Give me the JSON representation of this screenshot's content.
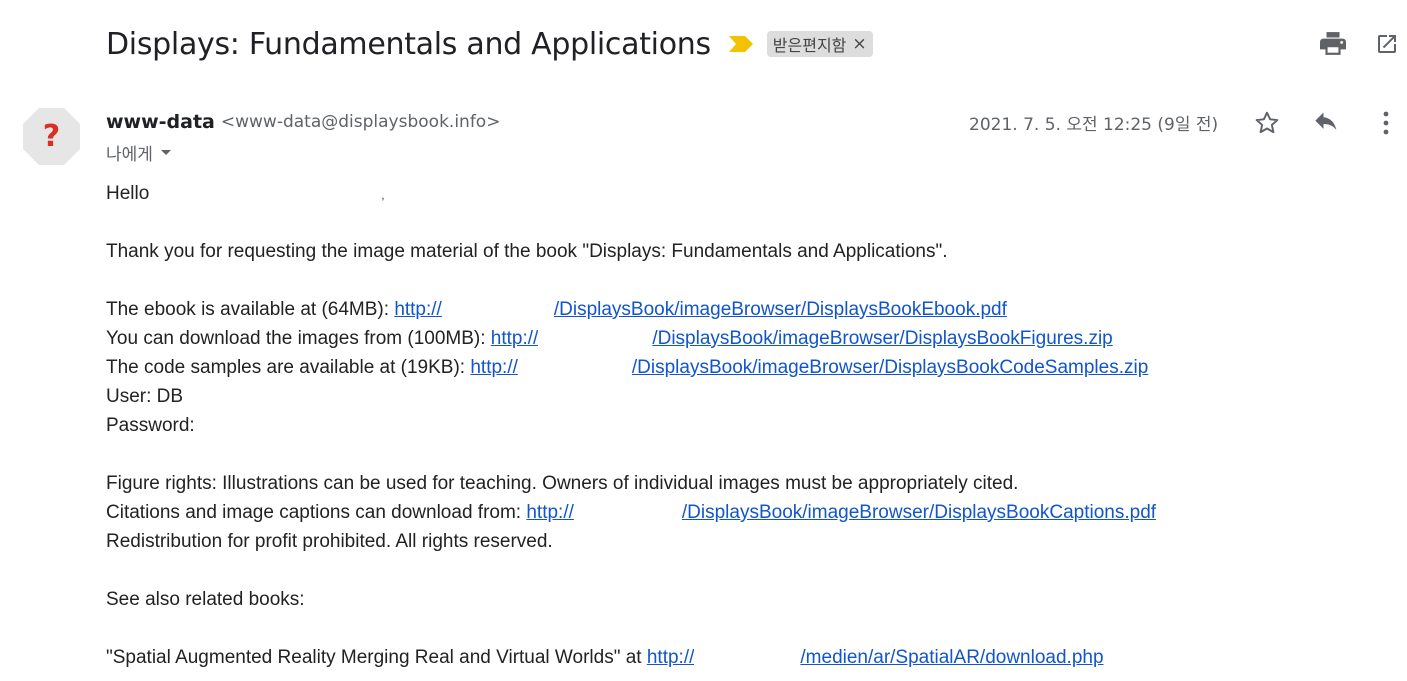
{
  "subject": {
    "title": "Displays: Fundamentals and Applications",
    "label": "받은편지함",
    "label_remove": "×"
  },
  "toolbar": {
    "print_icon": "print-icon",
    "popout_icon": "open-in-new-icon"
  },
  "message": {
    "avatar_glyph": "?",
    "sender_name": "www-data",
    "sender_email": "<www-data@displaysbook.info>",
    "to": "나에게",
    "date": "2021. 7. 5. 오전 12:25 (9일 전)",
    "icons": [
      "star-icon",
      "reply-icon",
      "more-vert-icon"
    ]
  },
  "body": {
    "greeting": "Hello",
    "greeting_tail": ",",
    "thanks": "Thank you for requesting the image material of the book \"Displays: Fundamentals and Applications\".",
    "ebook_prefix": "The ebook is available at (64MB): ",
    "ebook_link_a": "http://",
    "ebook_link_b": "/DisplaysBook/imageBrowser/DisplaysBookEbook.pdf",
    "images_prefix": "You can download the images from (100MB): ",
    "images_link_a": "http://",
    "images_link_b": "/DisplaysBook/imageBrowser/DisplaysBookFigures.zip",
    "code_prefix": "The code samples are available at (19KB):  ",
    "code_link_a": "http://",
    "code_link_b": "/DisplaysBook/imageBrowser/DisplaysBookCodeSamples.zip",
    "user": "User: DB",
    "password": "Password:",
    "rights": "Figure rights: Illustrations can be used for teaching. Owners of individual images must be appropriately cited.",
    "captions_prefix": "Citations and image captions can download from: ",
    "captions_link_a": "http://",
    "captions_link_b": "/DisplaysBook/imageBrowser/DisplaysBookCaptions.pdf",
    "redistribution": "Redistribution for profit prohibited. All rights reserved.",
    "see_also": "See also related books:",
    "related_prefix": "\"Spatial Augmented Reality Merging Real and Virtual Worlds\" at ",
    "related_link_a": "http://",
    "related_link_b": "/medien/ar/SpatialAR/download.php"
  }
}
